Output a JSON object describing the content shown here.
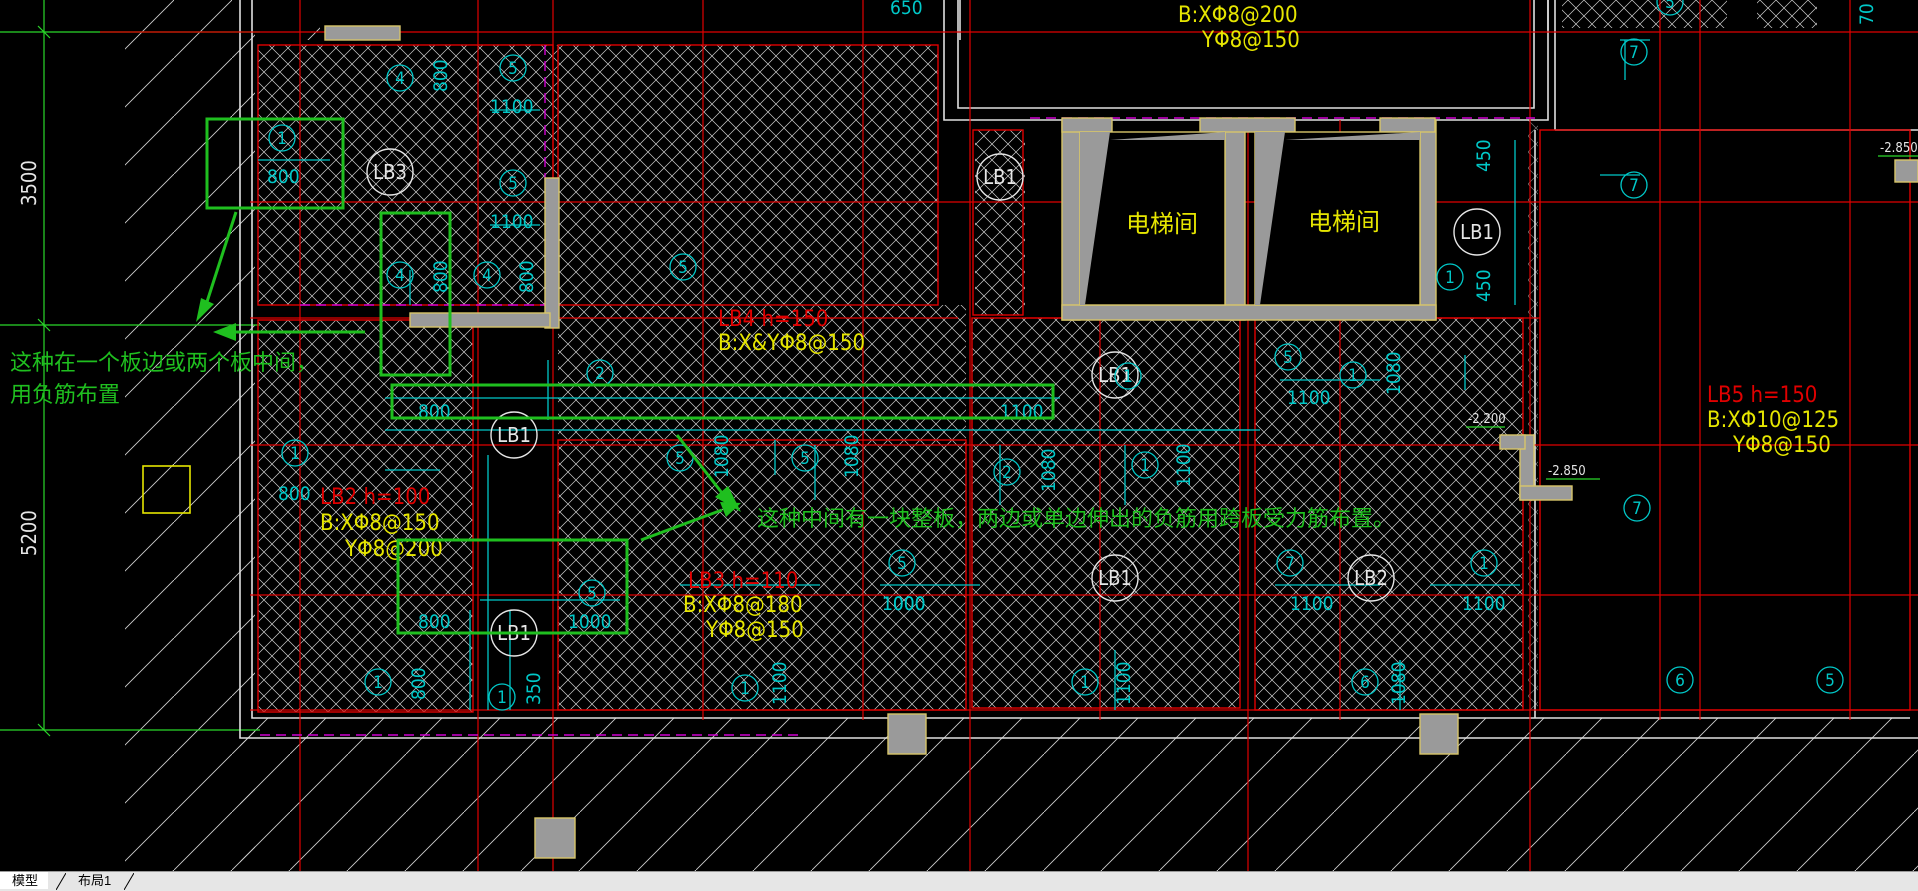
{
  "tabs": [
    {
      "label": "模型",
      "active": true
    },
    {
      "label": "布局1",
      "active": false
    }
  ],
  "colors": {
    "background": "#000000",
    "grid_red": "#e00000",
    "rebar_cyan": "#00c8c8",
    "annotation_yellow": "#e6e600",
    "highlight_green": "#1fbf1f",
    "wall_gray": "#9a9a9a",
    "hatch_white": "#d8d8d8",
    "outline_yellow": "#d8c66a",
    "dim_green": "#2ad82a"
  },
  "annotations": {
    "note_left_line1": "这种在一个板边或两个板中间，",
    "note_left_line2": "用负筋布置",
    "note_middle": "这种中间有一块整板，两边或单边伸出的负筋用跨板受力筋布置。"
  },
  "dimensions": {
    "vertical_upper": "3500",
    "vertical_lower": "5200"
  },
  "rooms": {
    "elevator_left": "电梯间",
    "elevator_right": "电梯间"
  },
  "slab_notes": {
    "top_bx": "B:XΦ8@200",
    "top_y": "YΦ8@150",
    "lb4_name": "LB4 h=150",
    "lb4_spec": "B:X&YΦ8@150",
    "lb2_name": "LB2 h=100",
    "lb2_x": "B:XΦ8@150",
    "lb2_y": "YΦ8@200",
    "lb3_name": "LB3 h=110",
    "lb3_x": "B:XΦ8@180",
    "lb3_y": "YΦ8@150",
    "lb5_name": "LB5 h=150",
    "lb5_x": "B:XΦ10@125",
    "lb5_y": "YΦ8@150"
  },
  "levels": {
    "lvl_right_top": "-2.850",
    "lvl_mid_1": "-2.200",
    "lvl_mid_2": "-2.850"
  },
  "slab_labels": [
    {
      "name": "lb3-tag",
      "text": "LB3"
    },
    {
      "name": "lb1-tag-1",
      "text": "LB1"
    },
    {
      "name": "lb1-tag-2",
      "text": "LB1"
    },
    {
      "name": "lb1-tag-3",
      "text": "LB1"
    },
    {
      "name": "lb1-tag-4",
      "text": "LB1"
    },
    {
      "name": "lb1-tag-5",
      "text": "LB1"
    },
    {
      "name": "lb1-tag-6",
      "text": "LB1"
    },
    {
      "name": "lb2-tag",
      "text": "LB2"
    }
  ],
  "rebar_marks": [
    "1",
    "4",
    "5",
    "5",
    "4",
    "4",
    "5",
    "2",
    "1",
    "5",
    "5",
    "2",
    "1",
    "5",
    "1",
    "5",
    "7",
    "1",
    "7",
    "7",
    "7",
    "1",
    "5",
    "1",
    "1",
    "1",
    "1",
    "6",
    "6",
    "5",
    "5",
    "1"
  ],
  "rebar_lengths": [
    "800",
    "800",
    "1100",
    "1100",
    "800",
    "800",
    "800",
    "1100",
    "800",
    "800",
    "1000",
    "800",
    "350",
    "1000",
    "1100",
    "1080",
    "1080",
    "1080",
    "1100",
    "1000",
    "1100",
    "1100",
    "1080",
    "1100",
    "1100",
    "450",
    "450",
    "1080",
    "800",
    "650",
    "1080",
    "70"
  ]
}
